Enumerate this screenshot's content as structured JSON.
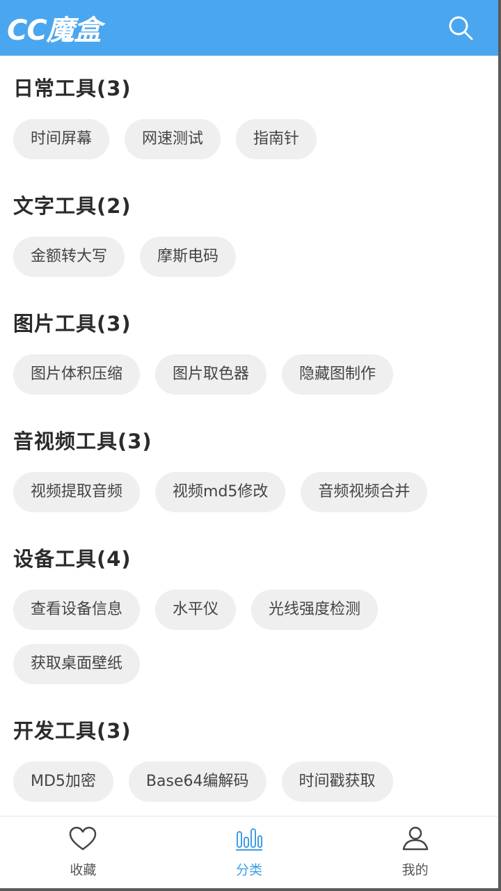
{
  "header": {
    "logo": "CC魔盒",
    "search_icon": "search-icon",
    "color": "#4aa6ee"
  },
  "sections": [
    {
      "title": "日常工具(3)",
      "items": [
        "时间屏幕",
        "网速测试",
        "指南针"
      ]
    },
    {
      "title": "文字工具(2)",
      "items": [
        "金额转大写",
        "摩斯电码"
      ]
    },
    {
      "title": "图片工具(3)",
      "items": [
        "图片体积压缩",
        "图片取色器",
        "隐藏图制作"
      ]
    },
    {
      "title": "音视频工具(3)",
      "items": [
        "视频提取音频",
        "视频md5修改",
        "音频视频合并"
      ]
    },
    {
      "title": "设备工具(4)",
      "items": [
        "查看设备信息",
        "水平仪",
        "光线强度检测",
        "获取桌面壁纸"
      ]
    },
    {
      "title": "开发工具(3)",
      "items": [
        "MD5加密",
        "Base64编解码",
        "时间戳获取"
      ]
    }
  ],
  "tabbar": {
    "tabs": [
      {
        "label": "收藏",
        "icon": "heart-icon"
      },
      {
        "label": "分类",
        "icon": "category-bars-icon",
        "active": true
      },
      {
        "label": "我的",
        "icon": "user-icon"
      }
    ],
    "active_color": "#3d9ee8"
  }
}
